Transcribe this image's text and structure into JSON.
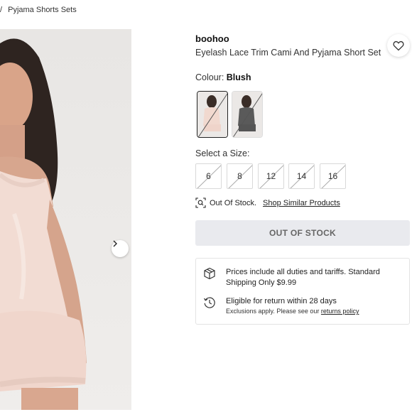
{
  "breadcrumb": {
    "separator": "/",
    "current": "Pyjama Shorts Sets"
  },
  "product": {
    "brand": "boohoo",
    "title": "Eyelash Lace Trim Cami And Pyjama Short Set",
    "colour_label": "Colour:",
    "colour_value": "Blush",
    "size_label": "Select a Size:",
    "sizes": [
      "6",
      "8",
      "12",
      "14",
      "16"
    ]
  },
  "stock": {
    "status_text": "Out Of Stock.",
    "similar_link": "Shop Similar Products",
    "button_label": "OUT OF STOCK"
  },
  "info": {
    "shipping_text": "Prices include all duties and tariffs. Standard Shipping Only $9.99",
    "returns_title": "Eligible for return within 28 days",
    "returns_note": "Exclusions apply. Please see our",
    "returns_link": "returns policy"
  },
  "icons": {
    "wishlist": "heart-icon",
    "next": "chevron-right-icon",
    "stock": "search-scan-icon",
    "shipping": "box-icon",
    "returns": "history-icon"
  },
  "colors": {
    "button_bg": "#e9eaee",
    "button_text": "#666666",
    "swatch_blush": "#f1d9cf",
    "swatch_grey": "#5a5a5a"
  }
}
